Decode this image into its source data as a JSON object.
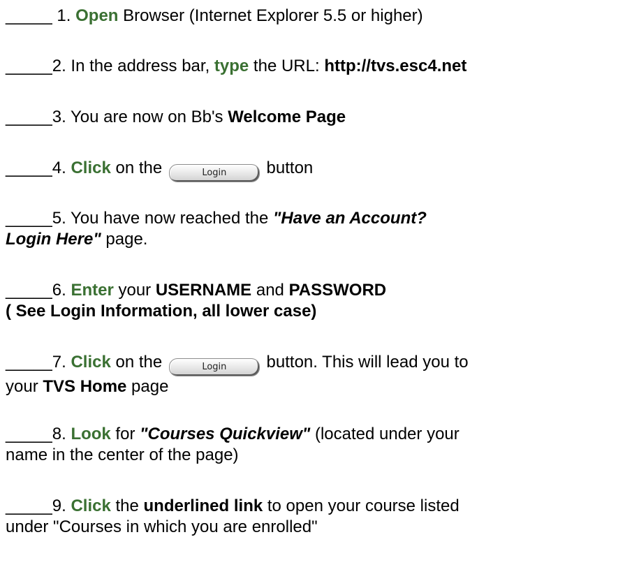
{
  "blank": "_____",
  "steps": {
    "s1": {
      "num": " 1. ",
      "verb": "Open",
      "rest": " Browser (Internet Explorer 5.5 or higher)"
    },
    "s2": {
      "num": "2. In the address bar, ",
      "verb": "type",
      "mid": " the URL: ",
      "url": "http://tvs.esc4.net"
    },
    "s3": {
      "num": "3. You are now on Bb's ",
      "bold": "Welcome Page"
    },
    "s4": {
      "num": "4. ",
      "verb": "Click",
      "mid": " on the ",
      "button": "Login",
      "rest": " button"
    },
    "s5": {
      "num": "5. You have now reached the ",
      "em1": "\"Have an Account?",
      "em2": "Login Here\"",
      "rest": " page."
    },
    "s6": {
      "num": "6. ",
      "verb": "Enter",
      "mid": " your ",
      "user": "USERNAME",
      "and": " and ",
      "pass": "PASSWORD",
      "line2": "( See Login Information, all lower case)"
    },
    "s7": {
      "num": "7. ",
      "verb": "Click",
      "mid": " on the ",
      "button": "Login",
      "rest": " button. This will lead you to",
      "line2a": "your ",
      "line2b": "TVS Home",
      "line2c": " page"
    },
    "s8": {
      "num": "8. ",
      "verb": "Look",
      "mid": " for ",
      "em": "\"Courses Quickview\"",
      "rest": " (located under your",
      "line2": "name in the center of the page)"
    },
    "s9": {
      "num": "9. ",
      "verb": "Click",
      "mid": " the ",
      "bold": "underlined link",
      "rest": " to open your course listed",
      "line2": "under \"Courses in which you are enrolled\""
    }
  },
  "colors": {
    "verb": "#3a7032",
    "text": "#000000",
    "background": "#ffffff"
  }
}
